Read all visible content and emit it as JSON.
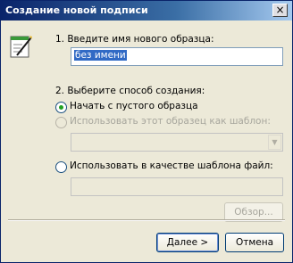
{
  "window": {
    "title": "Создание новой подписи",
    "close_glyph": "×"
  },
  "step1": {
    "label": "1. Введите имя нового образца:",
    "name_value": "без имени"
  },
  "step2": {
    "label": "2. Выберите способ создания:",
    "options": [
      {
        "label": "Начать с пустого образца",
        "checked": true,
        "enabled": true
      },
      {
        "label": "Использовать этот образец как шаблон:",
        "checked": false,
        "enabled": false
      },
      {
        "label": "Использовать в качестве шаблона файл:",
        "checked": false,
        "enabled": true
      }
    ],
    "template_select_value": "",
    "file_value": ""
  },
  "buttons": {
    "browse": "Обзор...",
    "next": "Далее >",
    "cancel": "Отмена"
  },
  "icons": {
    "header": "signature-wand-icon",
    "close": "close-icon",
    "combo_arrow": "chevron-down-icon"
  }
}
